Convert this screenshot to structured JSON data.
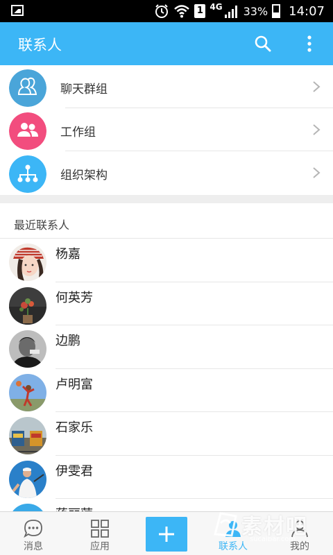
{
  "status_bar": {
    "network": "4G",
    "sim_slot": "1",
    "battery": "33%",
    "time": "14:07"
  },
  "app_bar": {
    "title": "联系人",
    "search_icon": "search-icon",
    "more_icon": "more-vertical-icon",
    "color": "#3cb6f6"
  },
  "groups": [
    {
      "label": "聊天群组",
      "icon": "chat-group-icon",
      "color": "#4aa5d9"
    },
    {
      "label": "工作组",
      "icon": "work-group-icon",
      "color": "#f24d7e"
    },
    {
      "label": "组织架构",
      "icon": "org-chart-icon",
      "color": "#3cb6f6"
    }
  ],
  "recent": {
    "header": "最近联系人",
    "contacts": [
      {
        "name": "杨嘉"
      },
      {
        "name": "何英芳"
      },
      {
        "name": "边鹏"
      },
      {
        "name": "卢明富"
      },
      {
        "name": "石家乐"
      },
      {
        "name": "伊雯君"
      },
      {
        "name": "蒋丽萍"
      }
    ]
  },
  "tabs": [
    {
      "label": "消息",
      "icon": "message-icon"
    },
    {
      "label": "应用",
      "icon": "apps-grid-icon"
    },
    {
      "label": "联系人",
      "icon": "contacts-icon",
      "active": true
    },
    {
      "label": "我的",
      "icon": "profile-icon"
    }
  ],
  "add_button": {
    "icon": "plus-icon",
    "color": "#3cb6f6"
  },
  "watermark": {
    "brand": "素材吧",
    "url": "sucaibar.com"
  }
}
